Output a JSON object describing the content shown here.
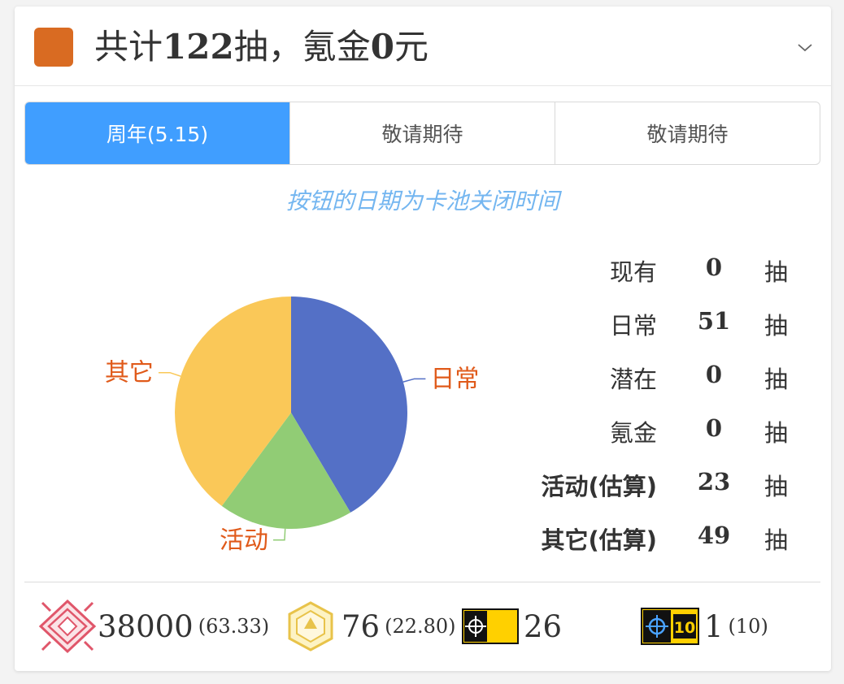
{
  "header": {
    "prefix": "共计",
    "total_pulls": "122",
    "middle": "抽，氪金",
    "spend": "0",
    "suffix": "元",
    "swatch_color": "#d96b22",
    "toggle_icon": "chevron-down-icon"
  },
  "tabs": [
    {
      "label": "周年(5.15)",
      "active": true
    },
    {
      "label": "敬请期待",
      "active": false
    },
    {
      "label": "敬请期待",
      "active": false
    }
  ],
  "colors": {
    "accent": "#409eff",
    "note": "#74b6f0",
    "pie_label": "#e05a1a"
  },
  "note": "按钮的日期为卡池关闭时间",
  "chart_data": {
    "type": "pie",
    "slices": [
      {
        "label": "日常",
        "value": 51,
        "color": "#5470c6"
      },
      {
        "label": "活动",
        "value": 23,
        "color": "#91cc75"
      },
      {
        "label": "其它",
        "value": 49,
        "color": "#fac858"
      }
    ]
  },
  "stats": [
    {
      "label": "现有",
      "value": "0",
      "unit": "抽"
    },
    {
      "label": "日常",
      "value": "51",
      "unit": "抽"
    },
    {
      "label": "潜在",
      "value": "0",
      "unit": "抽"
    },
    {
      "label": "氪金",
      "value": "0",
      "unit": "抽"
    },
    {
      "label": "活动(估算)",
      "value": "23",
      "unit": "抽"
    },
    {
      "label": "其它(估算)",
      "value": "49",
      "unit": "抽"
    }
  ],
  "resources": [
    {
      "icon": "orundum-icon",
      "amount": "38000",
      "note": "(63.33)"
    },
    {
      "icon": "originite-prime-icon",
      "amount": "76",
      "note": "(22.80)"
    },
    {
      "icon": "headhunting-permit-icon",
      "amount": "26",
      "note": ""
    },
    {
      "icon": "ten-roll-permit-icon",
      "amount": "1",
      "note": "(10)",
      "badge": "10"
    }
  ]
}
